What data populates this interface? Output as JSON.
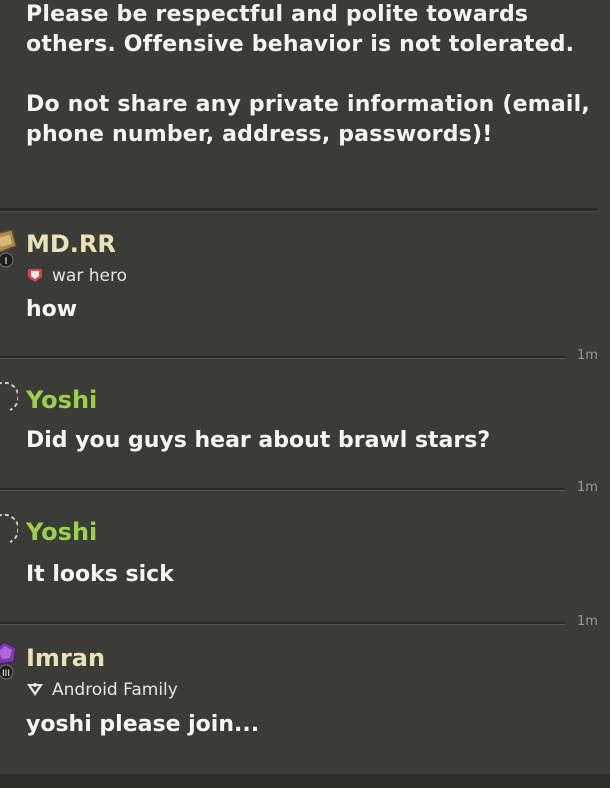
{
  "notice": {
    "line1": "Please be respectful and polite towards",
    "line2": "others. Offensive behavior is not tolerated.",
    "line3": "Do not share any private information (email,",
    "line4": "phone number, address, passwords)!"
  },
  "messages": [
    {
      "name": "MD.RR",
      "clan": "war hero",
      "text": "how",
      "time": "1m",
      "name_color": "#e8e2b8",
      "avatar_icon": "league-badge-icon",
      "clan_icon": "clan-badge-icon"
    },
    {
      "name": "Yoshi",
      "clan": "",
      "text": "Did you guys hear about brawl stars?",
      "time": "1m",
      "name_color": "#9ad04a",
      "avatar_icon": "avatar-outline-icon"
    },
    {
      "name": "Yoshi",
      "clan": "",
      "text": "It looks sick",
      "time": "1m",
      "name_color": "#9ad04a",
      "avatar_icon": "avatar-outline-icon"
    },
    {
      "name": "Imran",
      "clan": "Android Family",
      "text": "yoshi please join...",
      "time": "",
      "name_color": "#e8e2b8",
      "avatar_icon": "league-badge-icon",
      "clan_icon": "clan-badge-icon"
    }
  ],
  "colors": {
    "background": "#3b3b37",
    "member_name": "#e8e2b8",
    "friend_name": "#9ad04a"
  }
}
